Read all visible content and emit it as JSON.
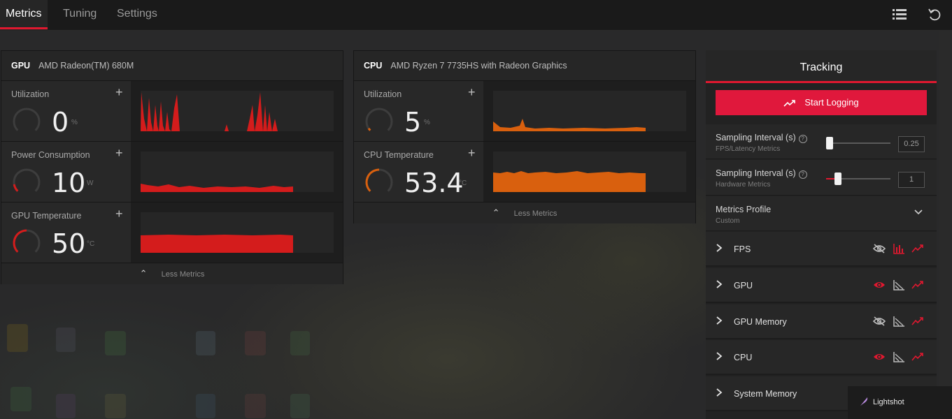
{
  "tabs": [
    {
      "label": "Metrics",
      "active": true
    },
    {
      "label": "Tuning",
      "active": false
    },
    {
      "label": "Settings",
      "active": false
    }
  ],
  "top_icons": [
    "list-icon",
    "reset-icon"
  ],
  "gpu_panel": {
    "type": "GPU",
    "device": "AMD Radeon(TM) 680M",
    "metrics": [
      {
        "label": "Utilization",
        "value": "0",
        "unit": "%",
        "level": 0.0
      },
      {
        "label": "Power Consumption",
        "value": "10",
        "unit": "W",
        "level": 0.12
      },
      {
        "label": "GPU Temperature",
        "value": "50",
        "unit": "°C",
        "level": 0.45
      }
    ],
    "footer": "Less Metrics"
  },
  "cpu_panel": {
    "type": "CPU",
    "device": "AMD Ryzen 7 7735HS with Radeon Graphics",
    "metrics": [
      {
        "label": "Utilization",
        "value": "5",
        "unit": "%",
        "level": 0.05
      },
      {
        "label": "CPU Temperature",
        "value": "53.4",
        "unit": "°C",
        "level": 0.45
      }
    ],
    "footer": "Less Metrics"
  },
  "tracking": {
    "title": "Tracking",
    "start_button": "Start Logging",
    "sampling_fps": {
      "label": "Sampling Interval (s)",
      "sublabel": "FPS/Latency Metrics",
      "value": "0.25",
      "level": 0.0
    },
    "sampling_hw": {
      "label": "Sampling Interval (s)",
      "sublabel": "Hardware Metrics",
      "value": "1",
      "level": 0.18
    },
    "profile": {
      "label": "Metrics Profile",
      "value": "Custom"
    },
    "categories": [
      {
        "name": "FPS",
        "visible": false
      },
      {
        "name": "GPU",
        "visible": true
      },
      {
        "name": "GPU Memory",
        "visible": false
      },
      {
        "name": "CPU",
        "visible": true
      },
      {
        "name": "System Memory",
        "visible": false
      }
    ]
  },
  "lightshot": {
    "label": "Lightshot"
  },
  "colors": {
    "accent": "#e0182f",
    "gpu_series": "#d41c1c",
    "cpu_series": "#d9600e"
  }
}
